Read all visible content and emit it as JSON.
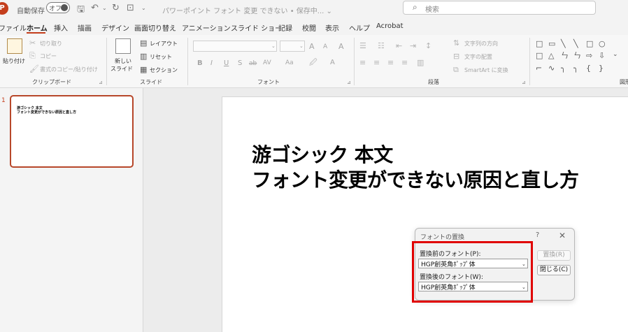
{
  "titlebar": {
    "logo_letter": "P",
    "autosave_label": "自動保存",
    "autosave_state": "オフ",
    "doc_title": "パワーポイント フォント 変更 できない • 保存中... ⌄",
    "search_placeholder": "検索",
    "icons": [
      "save-icon",
      "undo-icon",
      "redo-icon",
      "present-icon"
    ]
  },
  "tabs": [
    {
      "label": "ファイル"
    },
    {
      "label": "ホーム",
      "active": true
    },
    {
      "label": "挿入"
    },
    {
      "label": "描画"
    },
    {
      "label": "デザイン"
    },
    {
      "label": "画面切り替え"
    },
    {
      "label": "アニメーション"
    },
    {
      "label": "スライド ショー"
    },
    {
      "label": "記録"
    },
    {
      "label": "校閲"
    },
    {
      "label": "表示"
    },
    {
      "label": "ヘルプ"
    },
    {
      "label": "Acrobat"
    }
  ],
  "ribbon": {
    "clipboard": {
      "paste": "貼り付け",
      "cut": "切り取り",
      "copy": "コピー",
      "format_painter": "書式のコピー/貼り付け",
      "group_label": "クリップボード"
    },
    "slides": {
      "new_slide_1": "新しい",
      "new_slide_2": "スライド",
      "layout": "レイアウト",
      "reset": "リセット",
      "section": "セクション",
      "group_label": "スライド"
    },
    "font": {
      "font_size_up": "A",
      "font_size_down": "A",
      "clear_format": "A",
      "bold": "B",
      "italic": "I",
      "underline": "U",
      "strike": "S",
      "shadow": "ab",
      "spacing": "AV",
      "case": "Aa",
      "highlight": "A",
      "color": "A",
      "group_label": "フォント"
    },
    "paragraph": {
      "text_direction": "文字列の方向",
      "align_text": "文字の配置",
      "smartart": "SmartArt に変換",
      "group_label": "段落"
    },
    "drawing": {
      "group_label": "図形描画",
      "shapes": [
        "□",
        "▭",
        "╲",
        "╲",
        "□",
        "○",
        "□",
        "△",
        "ㄣ",
        "ㄣ",
        "⇨",
        "⇩",
        "⌐",
        "∿",
        "╮",
        "╮",
        "{",
        "}"
      ]
    }
  },
  "thumbnails": [
    {
      "number": "1",
      "line1": "游ゴシック 本文",
      "line2": "フォント変更ができない原因と直し方"
    }
  ],
  "slide": {
    "line1": "游ゴシック 本文",
    "line2": "フォント変更ができない原因と直し方"
  },
  "dialog": {
    "title": "フォントの置換",
    "help": "?",
    "close": "✕",
    "before_label": "置換前のフォント(P):",
    "before_value": "HGP創英角ﾎﾟｯﾌﾟ体",
    "after_label": "置換後のフォント(W):",
    "after_value": "HGP創英角ﾎﾟｯﾌﾟ体",
    "replace_button": "置換(R)",
    "close_button": "閉じる(C)"
  },
  "colors": {
    "accent": "#c43e1c",
    "highlight_box": "#e00000"
  }
}
